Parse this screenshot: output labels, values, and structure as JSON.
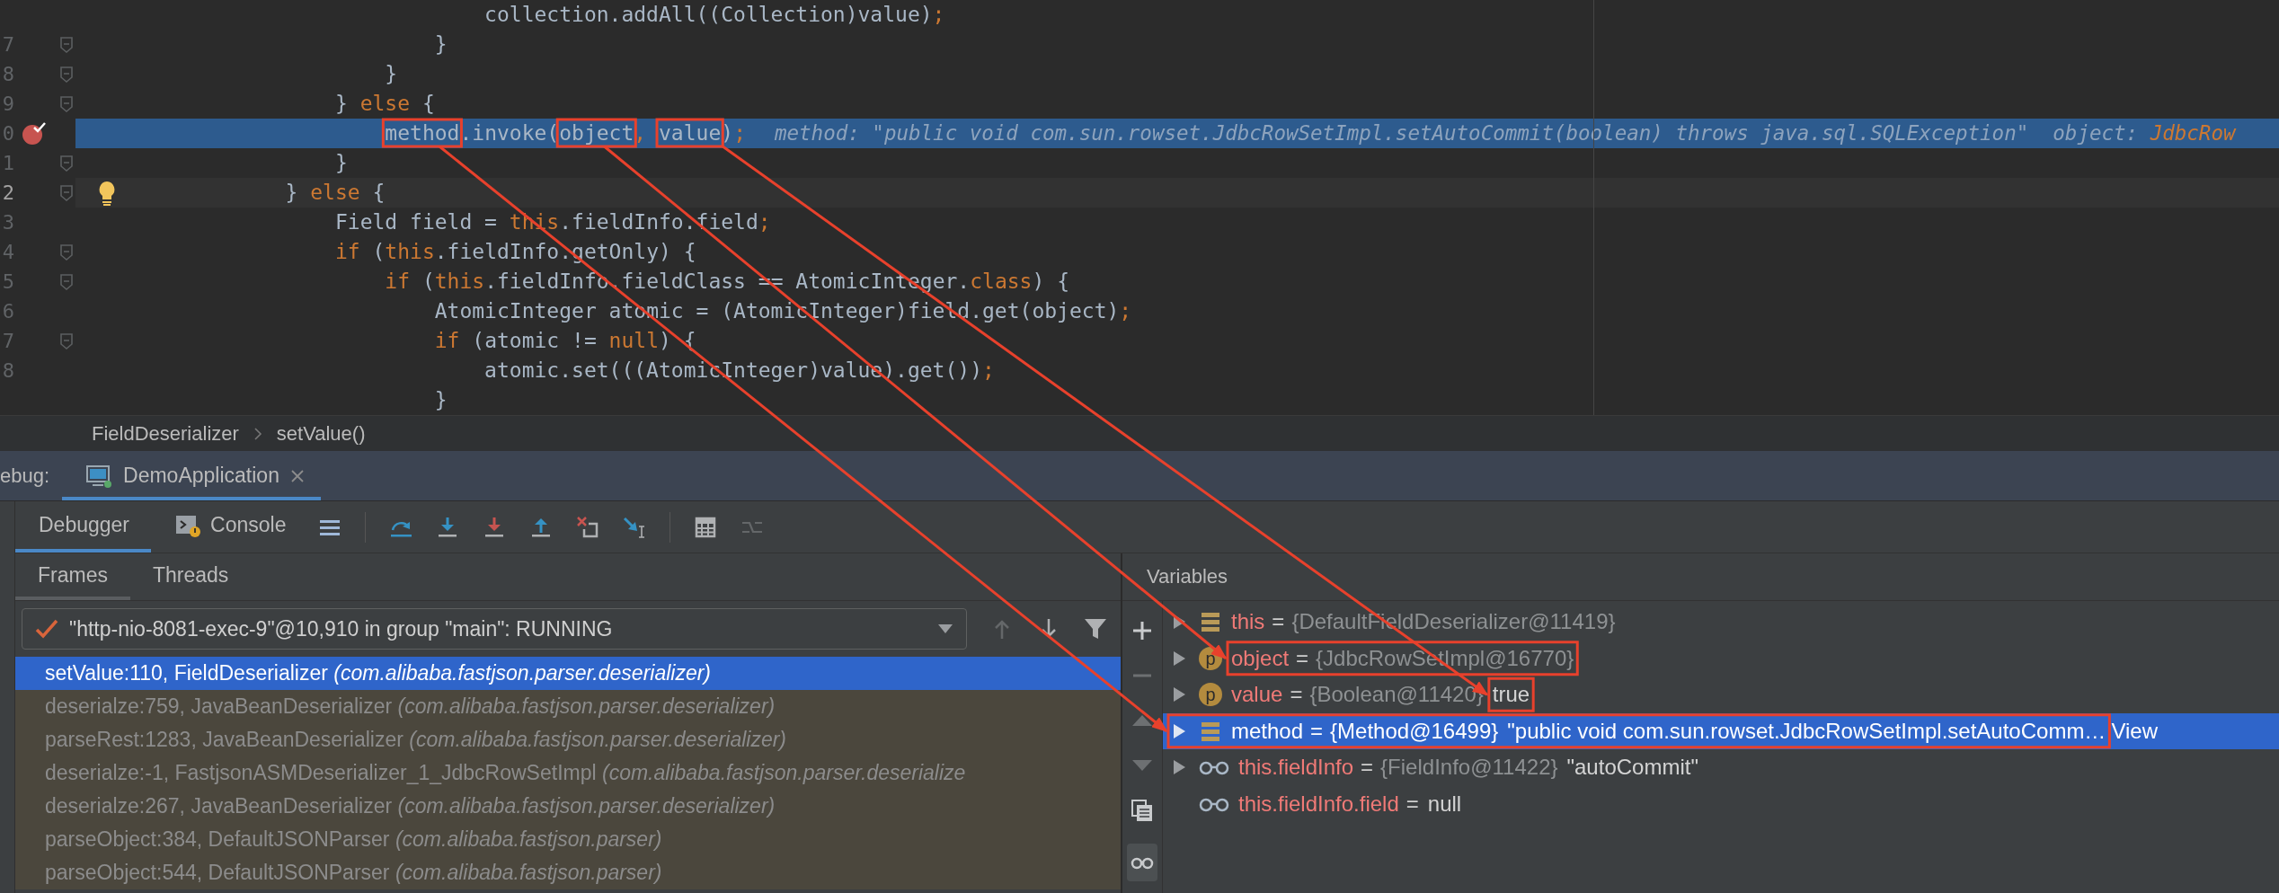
{
  "editor": {
    "lines": [
      {
        "segments": [
          {
            "text": "                                collection.addAll((Collection)value)",
            "kind": "plain"
          },
          {
            "text": ";",
            "kind": "keyword"
          }
        ]
      },
      {
        "number": "7",
        "fold": true,
        "segments": [
          {
            "text": "                            }",
            "kind": "plain"
          }
        ]
      },
      {
        "number": "8",
        "fold": true,
        "segments": [
          {
            "text": "                        }",
            "kind": "plain"
          }
        ]
      },
      {
        "number": "9",
        "fold": true,
        "segments": [
          {
            "text": "                    } ",
            "kind": "plain"
          },
          {
            "text": "else",
            "kind": "keyword"
          },
          {
            "text": " {",
            "kind": "plain"
          }
        ]
      },
      {
        "number": "0",
        "breakpoint": true,
        "executing": true,
        "segments": [
          {
            "text": "                        method",
            "kind": "plain",
            "framed": true
          },
          {
            "text": ".invoke(",
            "kind": "plain"
          },
          {
            "text": "object",
            "kind": "plain",
            "framed": true
          },
          {
            "text": ", ",
            "kind": "keyword"
          },
          {
            "text": "value",
            "kind": "plain",
            "framed": true
          },
          {
            "text": ")",
            "kind": "plain"
          },
          {
            "text": ";",
            "kind": "keyword"
          }
        ],
        "hints": [
          {
            "text": "method: \"public void com.sun.rowset.JdbcRowSetImpl.setAutoCommit(boolean) throws java.sql.SQLException\"",
            "kind": "hint"
          },
          {
            "text": "object:",
            "kind": "hint"
          },
          {
            "text": "JdbcRow",
            "kind": "hint_value"
          }
        ]
      },
      {
        "number": "1",
        "fold": true,
        "segments": [
          {
            "text": "                    }",
            "kind": "plain"
          }
        ]
      },
      {
        "number": "2",
        "fold": true,
        "bulb": true,
        "caret_line": true,
        "segments": [
          {
            "text": "                } ",
            "kind": "plain"
          },
          {
            "text": "else",
            "kind": "keyword"
          },
          {
            "text": " {",
            "kind": "plain"
          }
        ]
      },
      {
        "number": "3",
        "segments": [
          {
            "text": "                    Field field = ",
            "kind": "plain"
          },
          {
            "text": "this",
            "kind": "keyword"
          },
          {
            "text": ".fieldInfo.field",
            "kind": "plain"
          },
          {
            "text": ";",
            "kind": "keyword"
          }
        ]
      },
      {
        "number": "4",
        "fold": true,
        "segments": [
          {
            "text": "                    if",
            "kind": "keyword"
          },
          {
            "text": " (",
            "kind": "plain"
          },
          {
            "text": "this",
            "kind": "keyword"
          },
          {
            "text": ".fieldInfo.getOnly) {",
            "kind": "plain"
          }
        ]
      },
      {
        "number": "5",
        "fold": true,
        "segments": [
          {
            "text": "                        if",
            "kind": "keyword"
          },
          {
            "text": " (",
            "kind": "plain"
          },
          {
            "text": "this",
            "kind": "keyword"
          },
          {
            "text": ".fieldInfo.fieldClass == AtomicInteger.",
            "kind": "plain"
          },
          {
            "text": "class",
            "kind": "keyword"
          },
          {
            "text": ") {",
            "kind": "plain"
          }
        ]
      },
      {
        "number": "6",
        "segments": [
          {
            "text": "                            AtomicInteger atomic = (AtomicInteger)field.get(object)",
            "kind": "plain"
          },
          {
            "text": ";",
            "kind": "keyword"
          }
        ]
      },
      {
        "number": "7",
        "fold": true,
        "segments": [
          {
            "text": "                            if",
            "kind": "keyword"
          },
          {
            "text": " (atomic != ",
            "kind": "plain"
          },
          {
            "text": "null",
            "kind": "keyword"
          },
          {
            "text": ") {",
            "kind": "plain"
          }
        ]
      },
      {
        "number": "8",
        "segments": [
          {
            "text": "                                atomic.set(((AtomicInteger)value).get())",
            "kind": "plain"
          },
          {
            "text": ";",
            "kind": "keyword"
          }
        ]
      },
      {
        "segments": [
          {
            "text": "                            }",
            "kind": "plain"
          }
        ]
      }
    ]
  },
  "breadcrumb": [
    "FieldDeserializer",
    "setValue()"
  ],
  "debug": {
    "label": "ebug:",
    "sessions": [
      {
        "title": "DemoApplication",
        "selected": true
      }
    ],
    "subtabs": [
      {
        "label": "Debugger",
        "selected": true
      },
      {
        "label": "Console",
        "selected": false
      }
    ],
    "toolbar": [
      {
        "kind": "layout"
      },
      {
        "kind": "separator"
      },
      {
        "kind": "step_over"
      },
      {
        "kind": "step_into"
      },
      {
        "kind": "force_step_into"
      },
      {
        "kind": "step_out"
      },
      {
        "kind": "drop_frame"
      },
      {
        "kind": "run_to_cursor"
      },
      {
        "kind": "separator"
      },
      {
        "kind": "evaluate"
      },
      {
        "kind": "trace",
        "disabled": true
      }
    ],
    "frame_tabs": [
      {
        "label": "Frames",
        "selected": true
      },
      {
        "label": "Threads",
        "selected": false
      }
    ],
    "thread": "\"http-nio-8081-exec-9\"@10,910 in group \"main\": RUNNING",
    "frame_nav": [
      {
        "kind": "up",
        "disabled": true
      },
      {
        "kind": "down"
      },
      {
        "kind": "filter"
      }
    ],
    "frames": [
      {
        "text": "setValue:110, FieldDeserializer *(com.alibaba.fastjson.parser.deserializer)*",
        "selected": true
      },
      {
        "text": "deserialze:759, JavaBeanDeserializer *(com.alibaba.fastjson.parser.deserializer)*",
        "selected": false
      },
      {
        "text": "parseRest:1283, JavaBeanDeserializer *(com.alibaba.fastjson.parser.deserializer)*",
        "selected": false
      },
      {
        "text": "deserialze:-1, FastjsonASMDeserializer_1_JdbcRowSetImpl *(com.alibaba.fastjson.parser.deserialize*",
        "selected": false
      },
      {
        "text": "deserialze:267, JavaBeanDeserializer *(com.alibaba.fastjson.parser.deserializer)*",
        "selected": false
      },
      {
        "text": "parseObject:384, DefaultJSONParser *(com.alibaba.fastjson.parser)*",
        "selected": false
      },
      {
        "text": "parseObject:544, DefaultJSONParser *(com.alibaba.fastjson.parser)*",
        "selected": false
      }
    ],
    "variables_title": "Variables",
    "variable_tools": [
      {
        "kind": "add"
      },
      {
        "kind": "remove",
        "disabled": true
      },
      {
        "kind": "up",
        "disabled": true
      },
      {
        "kind": "down",
        "disabled": true
      },
      {
        "kind": "copy"
      },
      {
        "kind": "watches"
      }
    ],
    "variables": [
      {
        "kind": "field",
        "name": "this",
        "sign": "=",
        "value": "{DefaultFieldDeserializer@11419}",
        "expandable": true,
        "selected": false
      },
      {
        "kind": "parameter",
        "icon_text": "p",
        "name": "object",
        "sign": "=",
        "value": "{JdbcRowSetImpl@16770}",
        "expandable": true,
        "selected": false,
        "name_framed": true
      },
      {
        "kind": "parameter",
        "icon_text": "p",
        "name": "value",
        "sign": "=",
        "value": "{Boolean@11420}",
        "shown": "true",
        "expandable": true,
        "selected": false,
        "shown_framed": true
      },
      {
        "kind": "field",
        "name": "method",
        "sign": "=",
        "value": "{Method@16499}",
        "shown": "\"public void com.sun.rowset.JdbcRowSetImpl.setAutoComm…",
        "link": "View",
        "expandable": true,
        "selected": true,
        "row_framed": true
      },
      {
        "kind": "watch",
        "name": "this.fieldInfo",
        "sign": "=",
        "value": "{FieldInfo@11422}",
        "shown": "\"autoCommit\"",
        "expandable": true,
        "selected": false
      },
      {
        "kind": "watch",
        "name": "this.fieldInfo.field",
        "sign": "=",
        "shown": "null",
        "selected": false
      }
    ]
  }
}
